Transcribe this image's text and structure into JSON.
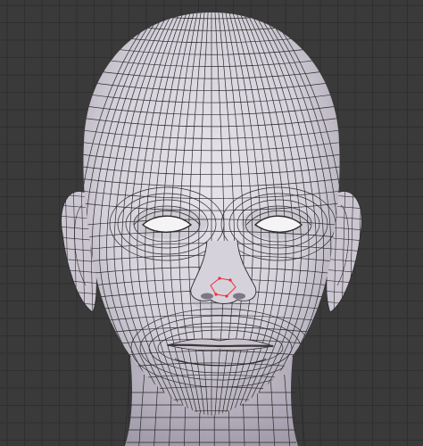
{
  "viewport": {
    "background_color": "#3a3a3a",
    "grid_color": "#2f2f2f",
    "grid_major_color": "#2a2a2a"
  },
  "model": {
    "mode": "wireframe-shaded",
    "surface_color": "#dcd9e0",
    "surface_shadow_color": "#a9a4b0",
    "wire_color": "#2b2b2b",
    "selection_color": "#e8303a",
    "eye_color": "#f4f3f6",
    "lip_line_color": "#3a3538"
  }
}
